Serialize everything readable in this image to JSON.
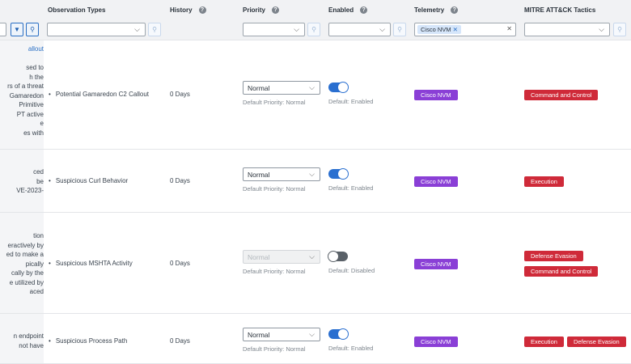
{
  "header": {
    "columns": {
      "observation_types": "Observation Types",
      "history": "History",
      "priority": "Priority",
      "enabled": "Enabled",
      "telemetry": "Telemetry",
      "mitre": "MITRE ATT&CK Tactics"
    },
    "telemetry_filter_chip": "Cisco NVM",
    "help_glyph": "?"
  },
  "rows": [
    {
      "left_fragments": [
        "allout",
        "",
        "sed to",
        "h the",
        "rs of a threat",
        "Gamaredon",
        "Primitive",
        "PT active",
        "e",
        "es with"
      ],
      "observation": "Potential Gamaredon C2 Callout",
      "history": "0 Days",
      "priority": "Normal",
      "default_priority": "Default Priority: Normal",
      "enabled": true,
      "default_enabled": "Default:  Enabled",
      "telemetry": "Cisco NVM",
      "tactics": [
        "Command and Control"
      ]
    },
    {
      "left_fragments": [
        "ced",
        "be",
        "VE-2023-"
      ],
      "observation": "Suspicious Curl Behavior",
      "history": "0 Days",
      "priority": "Normal",
      "default_priority": "Default Priority: Normal",
      "enabled": true,
      "default_enabled": "Default:  Enabled",
      "telemetry": "Cisco NVM",
      "tactics": [
        "Execution"
      ]
    },
    {
      "left_fragments": [
        "tion",
        "eractively by",
        "ed to make a",
        "pically",
        "cally by the",
        "e utilized by",
        "aced"
      ],
      "observation": "Suspicious MSHTA Activity",
      "history": "0 Days",
      "priority": "Normal",
      "default_priority": "Default Priority: Normal",
      "enabled": false,
      "default_enabled": "Default:  Disabled",
      "telemetry": "Cisco NVM",
      "tactics": [
        "Defense Evasion",
        "Command and Control"
      ]
    },
    {
      "left_fragments": [
        "n endpoint",
        "not have"
      ],
      "observation": "Suspicious Process Path",
      "history": "0 Days",
      "priority": "Normal",
      "default_priority": "Default Priority: Normal",
      "enabled": true,
      "default_enabled": "Default:  Enabled",
      "telemetry": "Cisco NVM",
      "tactics": [
        "Execution",
        "Defense Evasion"
      ]
    }
  ],
  "colors": {
    "telemetry_badge": "#8a3fd6",
    "tactic_badge": "#cf2a39",
    "toggle_on": "#2a6fd0",
    "link": "#2a6fc4"
  }
}
